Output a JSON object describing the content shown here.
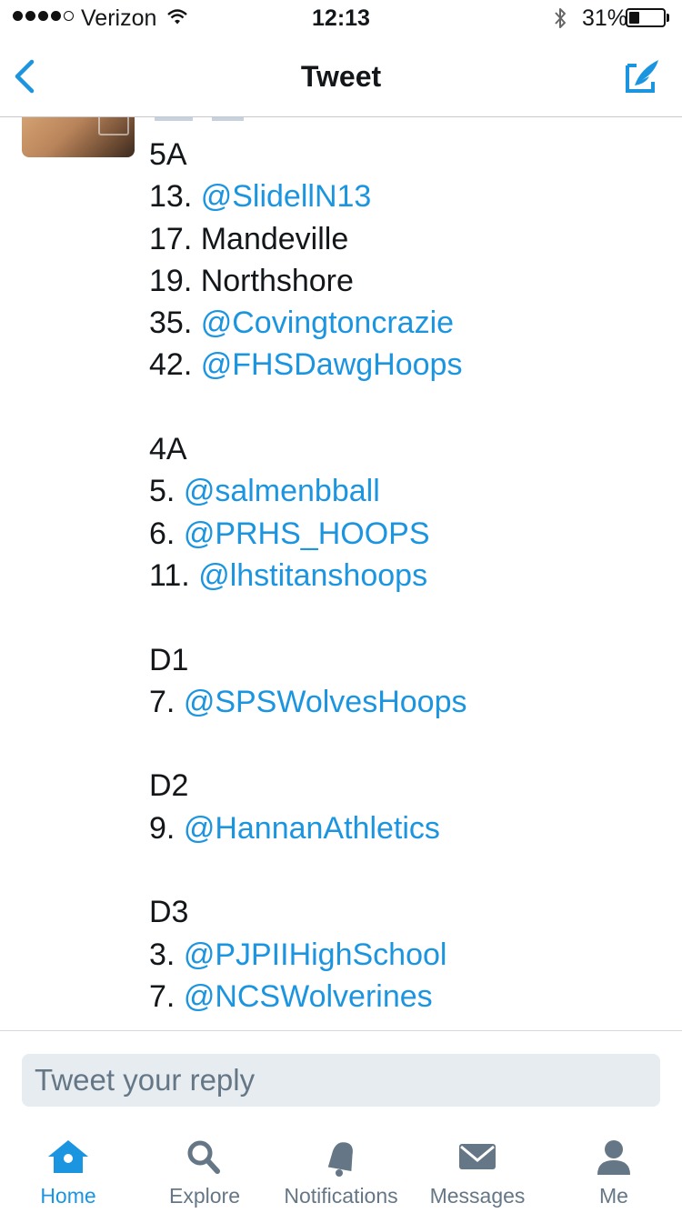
{
  "status_bar": {
    "carrier": "Verizon",
    "time": "12:13",
    "battery_percent": "31%",
    "battery_level": 0.31,
    "signal_bars_filled": 4,
    "signal_bars_total": 5
  },
  "nav": {
    "title": "Tweet",
    "back_icon": "chevron-left-icon",
    "compose_icon": "compose-tweet-icon"
  },
  "tweet": {
    "lines": [
      {
        "text": "5A",
        "type": "text"
      },
      {
        "prefix": "13. ",
        "text": "@SlidellN13",
        "type": "mention"
      },
      {
        "text": "17. Mandeville",
        "type": "text"
      },
      {
        "text": "19. Northshore",
        "type": "text"
      },
      {
        "prefix": "35. ",
        "text": "@Covingtoncrazie",
        "type": "mention"
      },
      {
        "prefix": "42. ",
        "text": "@FHSDawgHoops",
        "type": "mention"
      },
      {
        "text": "",
        "type": "blank"
      },
      {
        "text": "4A",
        "type": "text"
      },
      {
        "prefix": "5. ",
        "text": "@salmenbball",
        "type": "mention"
      },
      {
        "prefix": "6. ",
        "text": "@PRHS_HOOPS",
        "type": "mention"
      },
      {
        "prefix": "11. ",
        "text": "@lhstitanshoops",
        "type": "mention"
      },
      {
        "text": "",
        "type": "blank"
      },
      {
        "text": "D1",
        "type": "text"
      },
      {
        "prefix": "7. ",
        "text": "@SPSWolvesHoops",
        "type": "mention"
      },
      {
        "text": "",
        "type": "blank"
      },
      {
        "text": "D2",
        "type": "text"
      },
      {
        "prefix": "9. ",
        "text": "@HannanAthletics",
        "type": "mention"
      },
      {
        "text": "",
        "type": "blank"
      },
      {
        "text": "D3",
        "type": "text"
      },
      {
        "prefix": "3. ",
        "text": "@PJPIIHighSchool",
        "type": "mention"
      },
      {
        "prefix": "7. ",
        "text": "@NCSWolverines",
        "type": "mention"
      }
    ]
  },
  "reply": {
    "placeholder": "Tweet your reply"
  },
  "tabs": [
    {
      "label": "Home",
      "icon": "home-icon",
      "active": true
    },
    {
      "label": "Explore",
      "icon": "search-icon",
      "active": false
    },
    {
      "label": "Notifications",
      "icon": "bell-icon",
      "active": false
    },
    {
      "label": "Messages",
      "icon": "envelope-icon",
      "active": false
    },
    {
      "label": "Me",
      "icon": "person-icon",
      "active": false
    }
  ],
  "colors": {
    "accent": "#1b95e0",
    "inactive": "#657786",
    "text": "#14171a",
    "reply_bg": "#e6ecf0"
  }
}
